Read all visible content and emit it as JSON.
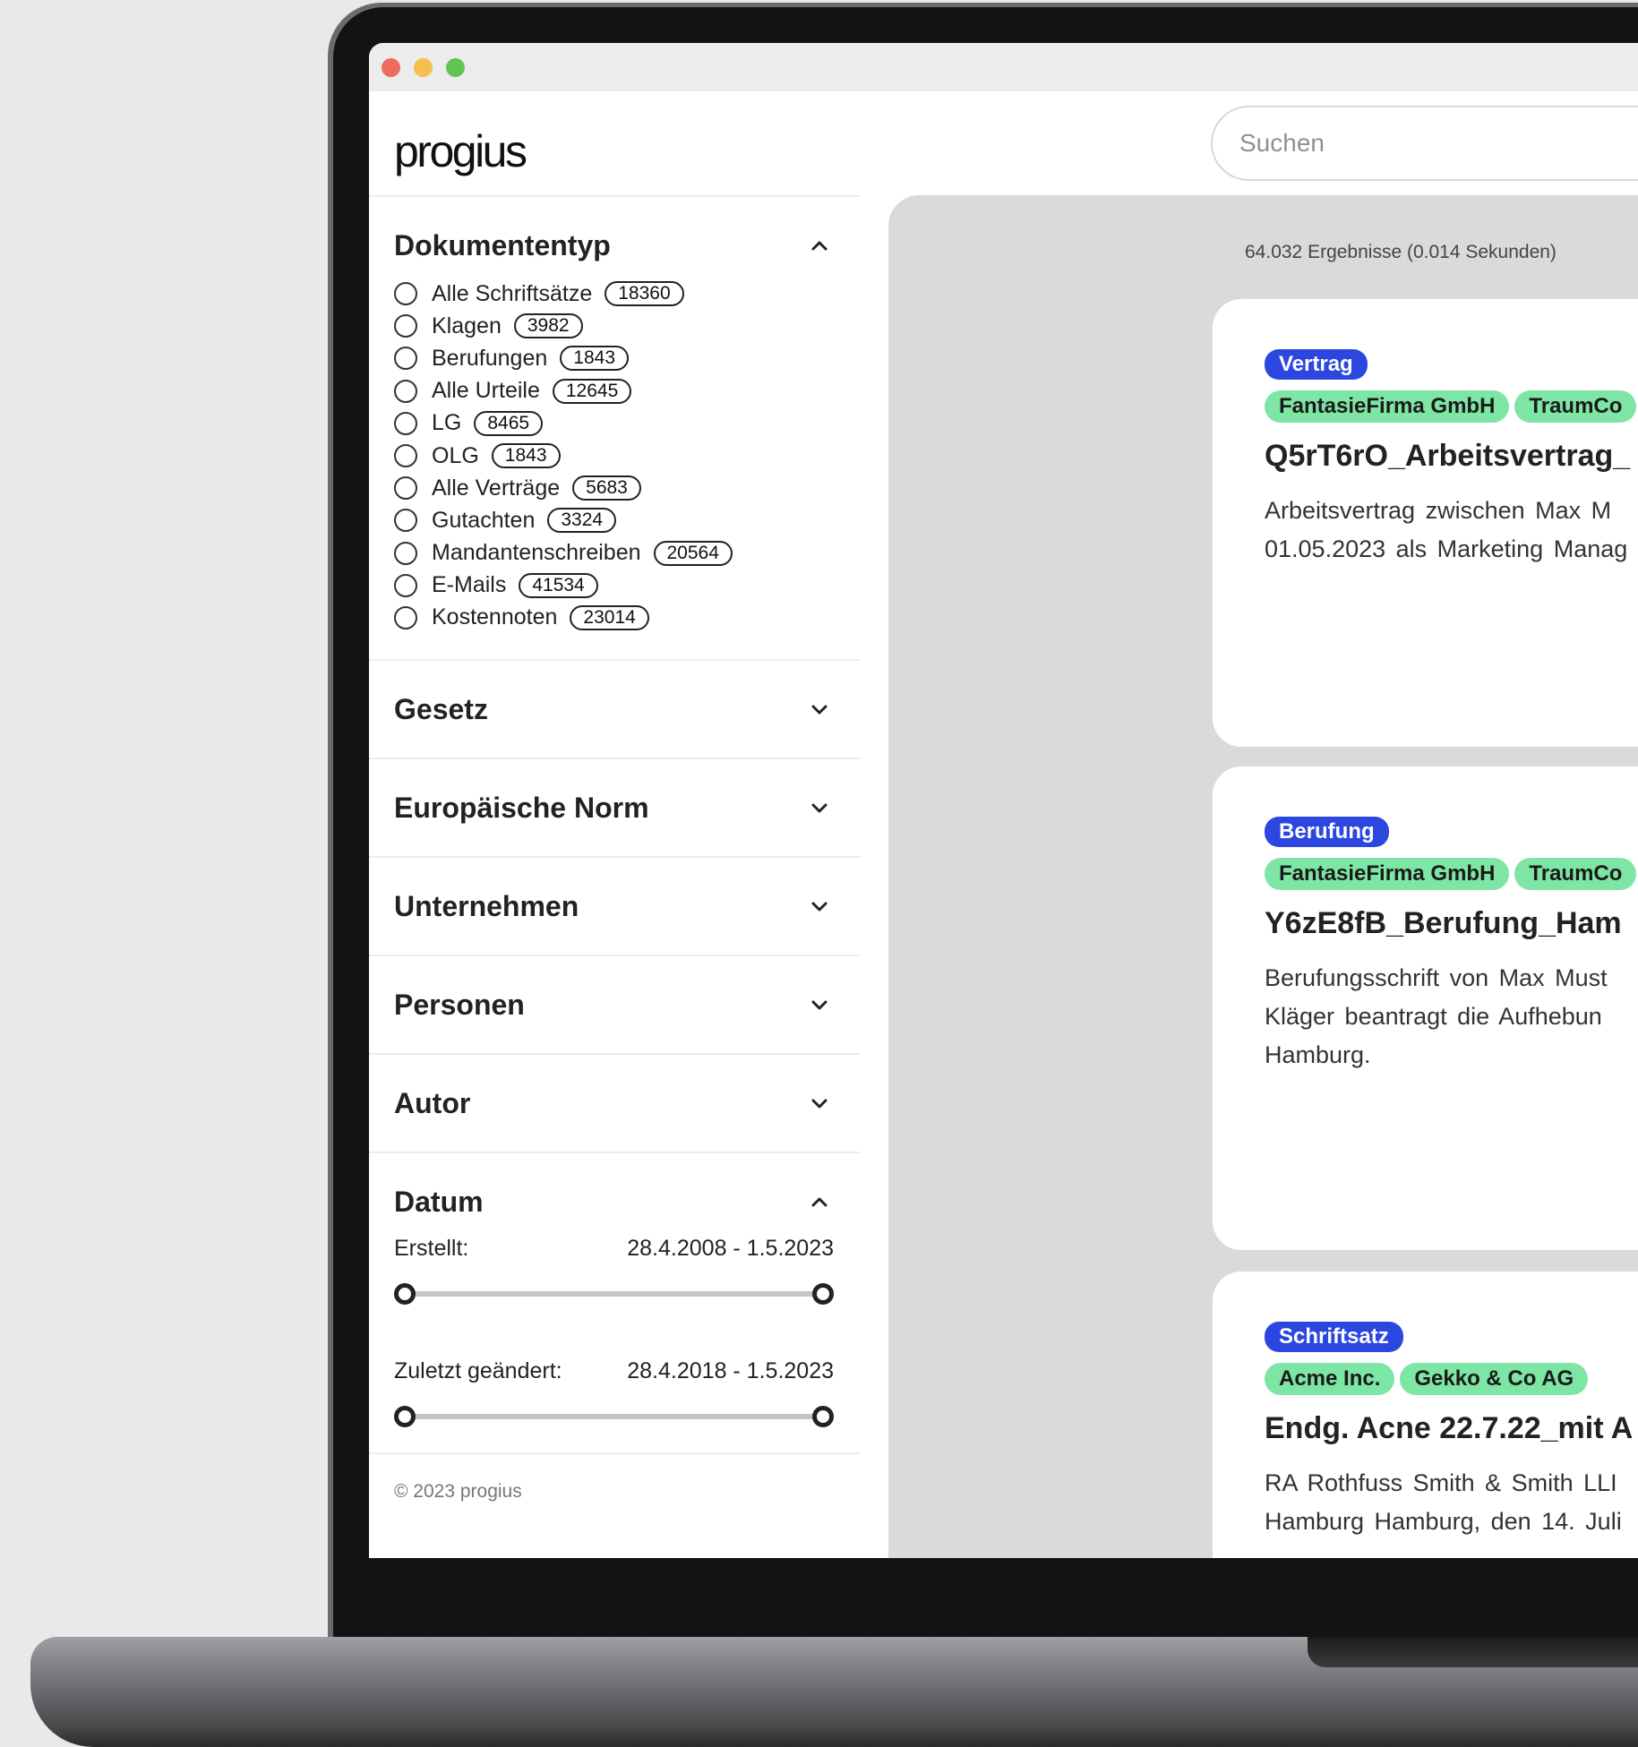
{
  "app": {
    "logo": "progius"
  },
  "search": {
    "placeholder": "Suchen"
  },
  "sidebar": {
    "dokumententyp": {
      "title": "Dokumententyp",
      "items": [
        {
          "label": "Alle Schriftsätze",
          "count": "18360"
        },
        {
          "label": "Klagen",
          "count": "3982"
        },
        {
          "label": "Berufungen",
          "count": "1843"
        },
        {
          "label": "Alle Urteile",
          "count": "12645"
        },
        {
          "label": "LG",
          "count": "8465"
        },
        {
          "label": "OLG",
          "count": "1843"
        },
        {
          "label": "Alle Verträge",
          "count": "5683"
        },
        {
          "label": "Gutachten",
          "count": "3324"
        },
        {
          "label": "Mandantenschreiben",
          "count": "20564"
        },
        {
          "label": "E-Mails",
          "count": "41534"
        },
        {
          "label": "Kostennoten",
          "count": "23014"
        }
      ]
    },
    "gesetz": "Gesetz",
    "europaeische_norm": "Europäische Norm",
    "unternehmen": "Unternehmen",
    "personen": "Personen",
    "autor": "Autor",
    "datum": {
      "title": "Datum",
      "erstellt_label": "Erstellt:",
      "erstellt_range": "28.4.2008 - 1.5.2023",
      "geaendert_label": "Zuletzt geändert:",
      "geaendert_range": "28.4.2018 - 1.5.2023"
    },
    "footer": "© 2023 progius"
  },
  "results": {
    "info": "64.032 Ergebnisse (0.014 Sekunden)",
    "cards": [
      {
        "type": "Vertrag",
        "tags": [
          "FantasieFirma GmbH",
          "TraumCo"
        ],
        "title": "Q5rT6rO_Arbeitsvertrag_",
        "text": [
          "Arbeitsvertrag zwischen Max M",
          "01.05.2023 als Marketing Manag"
        ]
      },
      {
        "type": "Berufung",
        "tags": [
          "FantasieFirma GmbH",
          "TraumCo"
        ],
        "title": "Y6zE8fB_Berufung_Ham",
        "text": [
          "Berufungsschrift von Max Must",
          "Kläger beantragt die Aufhebun",
          "Hamburg."
        ]
      },
      {
        "type": "Schriftsatz",
        "tags": [
          "Acme Inc.",
          "Gekko & Co AG"
        ],
        "title": "Endg. Acne 22.7.22_mit A",
        "text": [
          "RA Rothfuss Smith & Smith LLI",
          "Hamburg Hamburg, den 14. Juli"
        ]
      }
    ]
  },
  "colors": {
    "type_badge": "#2b47e0",
    "tag": "#7de6a4",
    "window_close": "#ed6a5e",
    "window_minimize": "#f5bf4f",
    "window_maximize": "#61c554"
  }
}
